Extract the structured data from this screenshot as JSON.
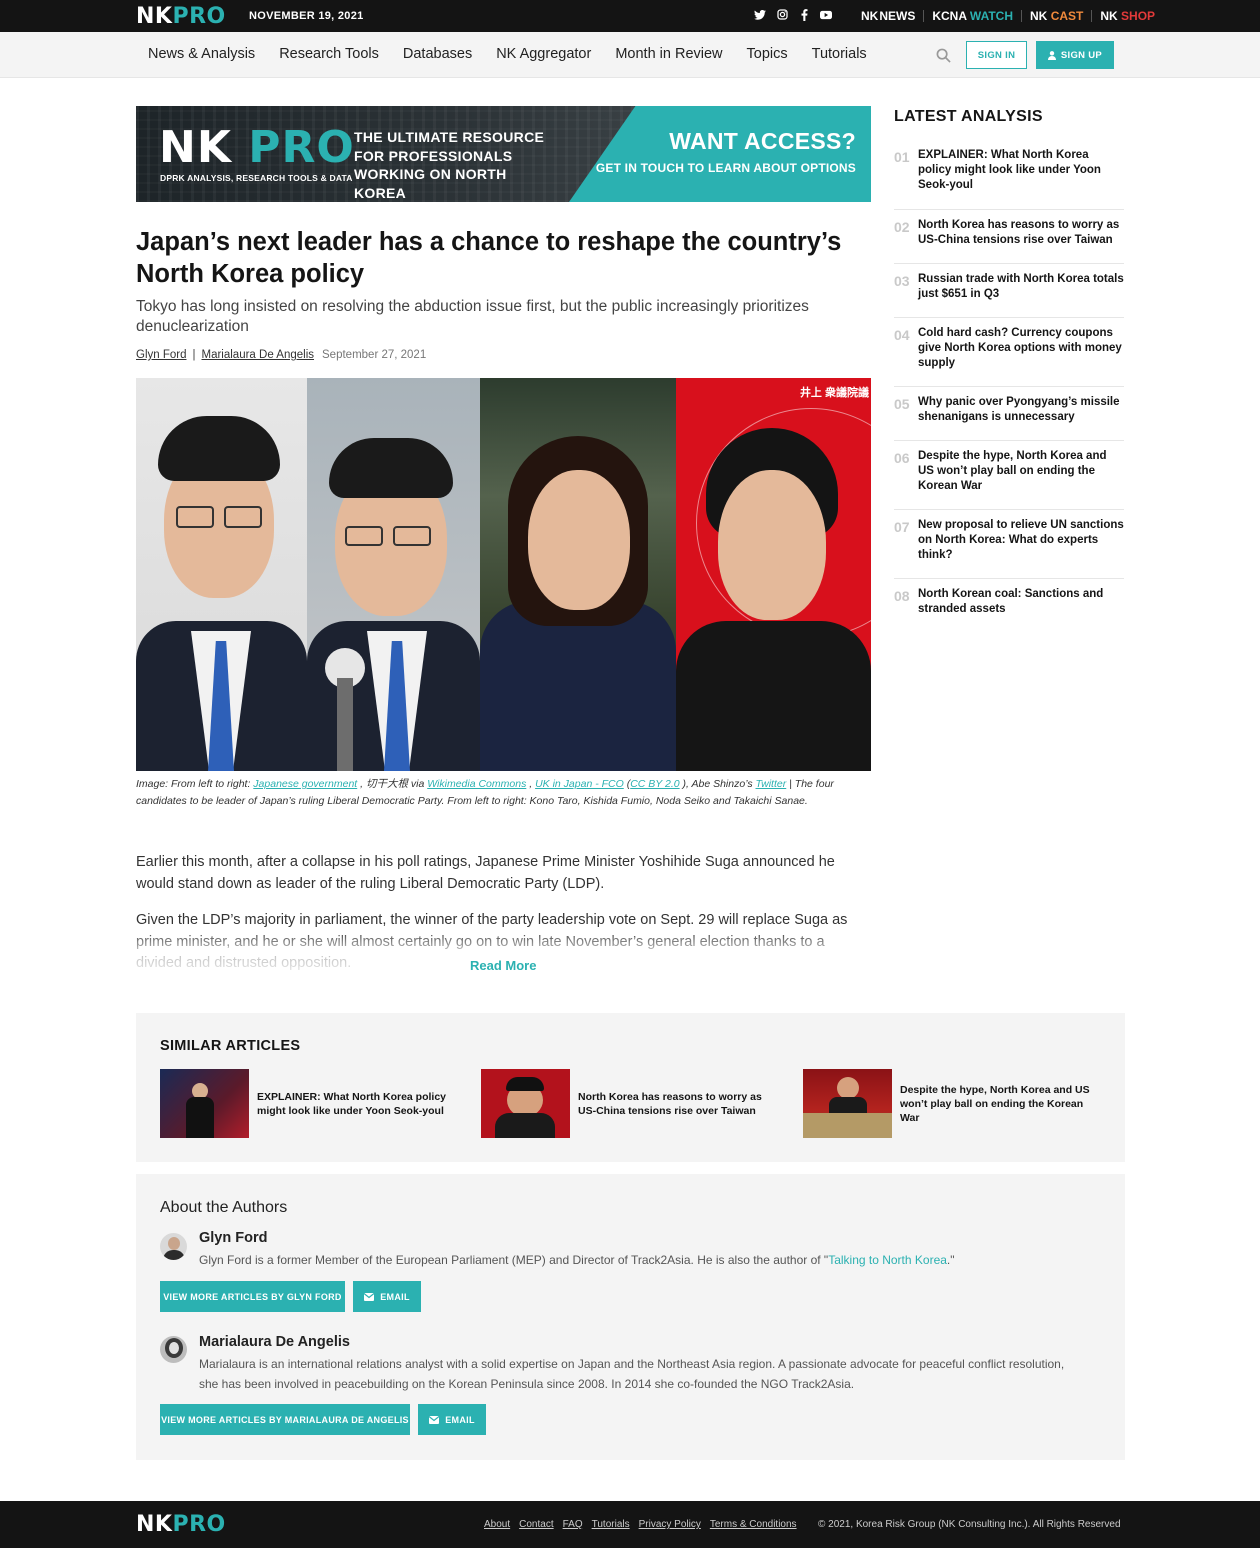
{
  "topbar": {
    "logo_nk": "NK",
    "logo_pro": "PRO",
    "date": "NOVEMBER 19, 2021",
    "social_icons": [
      "twitter-icon",
      "instagram-icon",
      "facebook-icon",
      "youtube-icon"
    ],
    "sites": [
      {
        "a": "NK",
        "b": "NEWS"
      },
      {
        "a": "KCNA ",
        "b": "WATCH"
      },
      {
        "a": "NK ",
        "b": "CAST"
      },
      {
        "a": "NK ",
        "b": "SHOP"
      }
    ]
  },
  "nav": {
    "items": [
      "News & Analysis",
      "Research Tools",
      "Databases",
      "NK Aggregator",
      "Month in Review",
      "Topics",
      "Tutorials"
    ],
    "sign_in": "SIGN IN",
    "sign_up": "SIGN UP"
  },
  "banner": {
    "logo_nk": "NK",
    "logo_pro": "PRO",
    "sub": "DPRK ANALYSIS, RESEARCH TOOLS & DATA",
    "tagline": "THE ULTIMATE RESOURCE FOR PROFESSIONALS WORKING ON NORTH KOREA",
    "cta_title": "WANT ACCESS?",
    "cta_sub": "GET IN TOUCH TO LEARN ABOUT OPTIONS"
  },
  "article": {
    "title": "Japan’s next leader has a chance to reshape the country’s North Korea policy",
    "subtitle": "Tokyo has long insisted on resolving the abduction issue first, but the public increasingly prioritizes denuclearization",
    "author1": "Glyn Ford",
    "sep": "|",
    "author2": "Marialaura De Angelis",
    "date": "September 27, 2021",
    "image_kanji": "井上 衆議院議",
    "caption": {
      "p1": "Image: From left to right: ",
      "l1": "Japanese government",
      "p2": " , 切干大根 via ",
      "l2": "Wikimedia Commons",
      "p3": " , ",
      "l3": "UK in Japan - FCO",
      "p4": "  (",
      "l4": "CC BY 2.0",
      "p5": " ), Abe Shinzo’s ",
      "l5": "Twitter",
      "p6": " | The four candidates to be leader of Japan’s ruling Liberal Democratic Party. From left to right: Kono Taro, Kishida Fumio, Noda Seiko and Takaichi Sanae."
    },
    "para1": "Earlier this month, after a collapse in his poll ratings, Japanese Prime Minister Yoshihide Suga announced he would stand down as leader of the ruling Liberal Democratic Party (LDP).",
    "para2": "Given the LDP’s majority in parliament, the winner of the party leadership vote on Sept. 29 will replace Suga as prime minister, and he or she will almost certainly go on to win late November’s general election thanks to a divided and distrusted opposition.",
    "read_more": "Read More"
  },
  "sidebar": {
    "heading": "LATEST ANALYSIS",
    "items": [
      {
        "num": "01",
        "text": "EXPLAINER: What North Korea policy might look like under Yoon Seok-youl"
      },
      {
        "num": "02",
        "text": "North Korea has reasons to worry as US-China tensions rise over Taiwan"
      },
      {
        "num": "03",
        "text": "Russian trade with North Korea totals just $651 in Q3"
      },
      {
        "num": "04",
        "text": "Cold hard cash? Currency coupons give North Korea options with money supply"
      },
      {
        "num": "05",
        "text": "Why panic over Pyongyang’s missile shenanigans is unnecessary"
      },
      {
        "num": "06",
        "text": "Despite the hype, North Korea and US won’t play ball on ending the Korean War"
      },
      {
        "num": "07",
        "text": "New proposal to relieve UN sanctions on North Korea: What do experts think?"
      },
      {
        "num": "08",
        "text": "North Korean coal: Sanctions and stranded assets"
      }
    ]
  },
  "similar": {
    "heading": "SIMILAR ARTICLES",
    "items": [
      {
        "text": "EXPLAINER: What North Korea policy might look like under Yoon Seok-youl"
      },
      {
        "text": "North Korea has reasons to worry as US-China tensions rise over Taiwan"
      },
      {
        "text": "Despite the hype, North Korea and US won’t play ball on ending the Korean War"
      }
    ]
  },
  "authors": {
    "heading": "About the Authors",
    "a1": {
      "name": "Glyn Ford",
      "bio_pre": "Glyn Ford is a former Member of the European Parliament (MEP) and Director of Track2Asia. He is also the author of \"",
      "bio_link": "Talking to North Korea",
      "bio_post": ".\"",
      "more": "VIEW MORE ARTICLES BY GLYN FORD",
      "email": "EMAIL"
    },
    "a2": {
      "name": "Marialaura De Angelis",
      "bio": "Marialaura is an international relations analyst with a solid expertise on Japan and the Northeast Asia region. A passionate advocate for peaceful conflict resolution, she has been involved in peacebuilding on the Korean Peninsula since 2008. In 2014 she co-founded the NGO Track2Asia.",
      "more": "VIEW MORE ARTICLES BY MARIALAURA DE ANGELIS",
      "email": "EMAIL"
    }
  },
  "footer": {
    "logo_nk": "NK",
    "logo_pro": "PRO",
    "links": [
      "About",
      "Contact",
      "FAQ",
      "Tutorials",
      "Privacy Policy",
      "Terms & Conditions"
    ],
    "copyright": "© 2021, Korea Risk Group (NK Consulting Inc.). All Rights Reserved"
  },
  "colors": {
    "accent": "#2bb1b1",
    "dark": "#141414"
  }
}
